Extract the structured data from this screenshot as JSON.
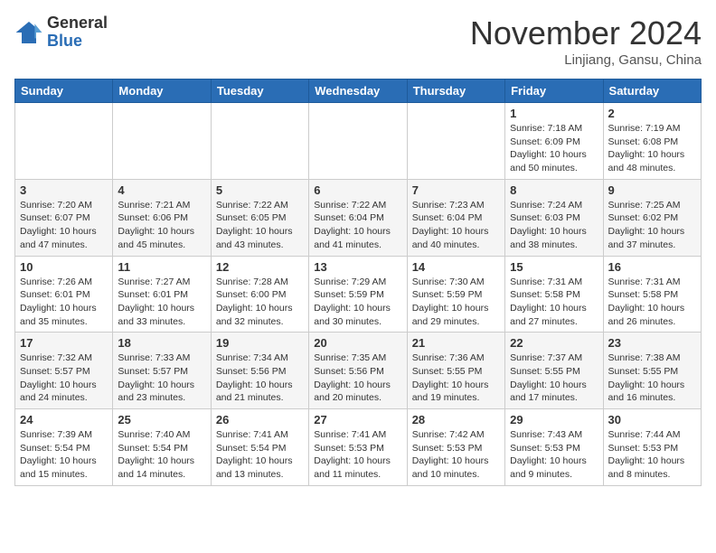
{
  "header": {
    "logo_general": "General",
    "logo_blue": "Blue",
    "month_title": "November 2024",
    "location": "Linjiang, Gansu, China"
  },
  "weekdays": [
    "Sunday",
    "Monday",
    "Tuesday",
    "Wednesday",
    "Thursday",
    "Friday",
    "Saturday"
  ],
  "weeks": [
    [
      {
        "day": "",
        "info": ""
      },
      {
        "day": "",
        "info": ""
      },
      {
        "day": "",
        "info": ""
      },
      {
        "day": "",
        "info": ""
      },
      {
        "day": "",
        "info": ""
      },
      {
        "day": "1",
        "info": "Sunrise: 7:18 AM\nSunset: 6:09 PM\nDaylight: 10 hours\nand 50 minutes."
      },
      {
        "day": "2",
        "info": "Sunrise: 7:19 AM\nSunset: 6:08 PM\nDaylight: 10 hours\nand 48 minutes."
      }
    ],
    [
      {
        "day": "3",
        "info": "Sunrise: 7:20 AM\nSunset: 6:07 PM\nDaylight: 10 hours\nand 47 minutes."
      },
      {
        "day": "4",
        "info": "Sunrise: 7:21 AM\nSunset: 6:06 PM\nDaylight: 10 hours\nand 45 minutes."
      },
      {
        "day": "5",
        "info": "Sunrise: 7:22 AM\nSunset: 6:05 PM\nDaylight: 10 hours\nand 43 minutes."
      },
      {
        "day": "6",
        "info": "Sunrise: 7:22 AM\nSunset: 6:04 PM\nDaylight: 10 hours\nand 41 minutes."
      },
      {
        "day": "7",
        "info": "Sunrise: 7:23 AM\nSunset: 6:04 PM\nDaylight: 10 hours\nand 40 minutes."
      },
      {
        "day": "8",
        "info": "Sunrise: 7:24 AM\nSunset: 6:03 PM\nDaylight: 10 hours\nand 38 minutes."
      },
      {
        "day": "9",
        "info": "Sunrise: 7:25 AM\nSunset: 6:02 PM\nDaylight: 10 hours\nand 37 minutes."
      }
    ],
    [
      {
        "day": "10",
        "info": "Sunrise: 7:26 AM\nSunset: 6:01 PM\nDaylight: 10 hours\nand 35 minutes."
      },
      {
        "day": "11",
        "info": "Sunrise: 7:27 AM\nSunset: 6:01 PM\nDaylight: 10 hours\nand 33 minutes."
      },
      {
        "day": "12",
        "info": "Sunrise: 7:28 AM\nSunset: 6:00 PM\nDaylight: 10 hours\nand 32 minutes."
      },
      {
        "day": "13",
        "info": "Sunrise: 7:29 AM\nSunset: 5:59 PM\nDaylight: 10 hours\nand 30 minutes."
      },
      {
        "day": "14",
        "info": "Sunrise: 7:30 AM\nSunset: 5:59 PM\nDaylight: 10 hours\nand 29 minutes."
      },
      {
        "day": "15",
        "info": "Sunrise: 7:31 AM\nSunset: 5:58 PM\nDaylight: 10 hours\nand 27 minutes."
      },
      {
        "day": "16",
        "info": "Sunrise: 7:31 AM\nSunset: 5:58 PM\nDaylight: 10 hours\nand 26 minutes."
      }
    ],
    [
      {
        "day": "17",
        "info": "Sunrise: 7:32 AM\nSunset: 5:57 PM\nDaylight: 10 hours\nand 24 minutes."
      },
      {
        "day": "18",
        "info": "Sunrise: 7:33 AM\nSunset: 5:57 PM\nDaylight: 10 hours\nand 23 minutes."
      },
      {
        "day": "19",
        "info": "Sunrise: 7:34 AM\nSunset: 5:56 PM\nDaylight: 10 hours\nand 21 minutes."
      },
      {
        "day": "20",
        "info": "Sunrise: 7:35 AM\nSunset: 5:56 PM\nDaylight: 10 hours\nand 20 minutes."
      },
      {
        "day": "21",
        "info": "Sunrise: 7:36 AM\nSunset: 5:55 PM\nDaylight: 10 hours\nand 19 minutes."
      },
      {
        "day": "22",
        "info": "Sunrise: 7:37 AM\nSunset: 5:55 PM\nDaylight: 10 hours\nand 17 minutes."
      },
      {
        "day": "23",
        "info": "Sunrise: 7:38 AM\nSunset: 5:55 PM\nDaylight: 10 hours\nand 16 minutes."
      }
    ],
    [
      {
        "day": "24",
        "info": "Sunrise: 7:39 AM\nSunset: 5:54 PM\nDaylight: 10 hours\nand 15 minutes."
      },
      {
        "day": "25",
        "info": "Sunrise: 7:40 AM\nSunset: 5:54 PM\nDaylight: 10 hours\nand 14 minutes."
      },
      {
        "day": "26",
        "info": "Sunrise: 7:41 AM\nSunset: 5:54 PM\nDaylight: 10 hours\nand 13 minutes."
      },
      {
        "day": "27",
        "info": "Sunrise: 7:41 AM\nSunset: 5:53 PM\nDaylight: 10 hours\nand 11 minutes."
      },
      {
        "day": "28",
        "info": "Sunrise: 7:42 AM\nSunset: 5:53 PM\nDaylight: 10 hours\nand 10 minutes."
      },
      {
        "day": "29",
        "info": "Sunrise: 7:43 AM\nSunset: 5:53 PM\nDaylight: 10 hours\nand 9 minutes."
      },
      {
        "day": "30",
        "info": "Sunrise: 7:44 AM\nSunset: 5:53 PM\nDaylight: 10 hours\nand 8 minutes."
      }
    ]
  ]
}
